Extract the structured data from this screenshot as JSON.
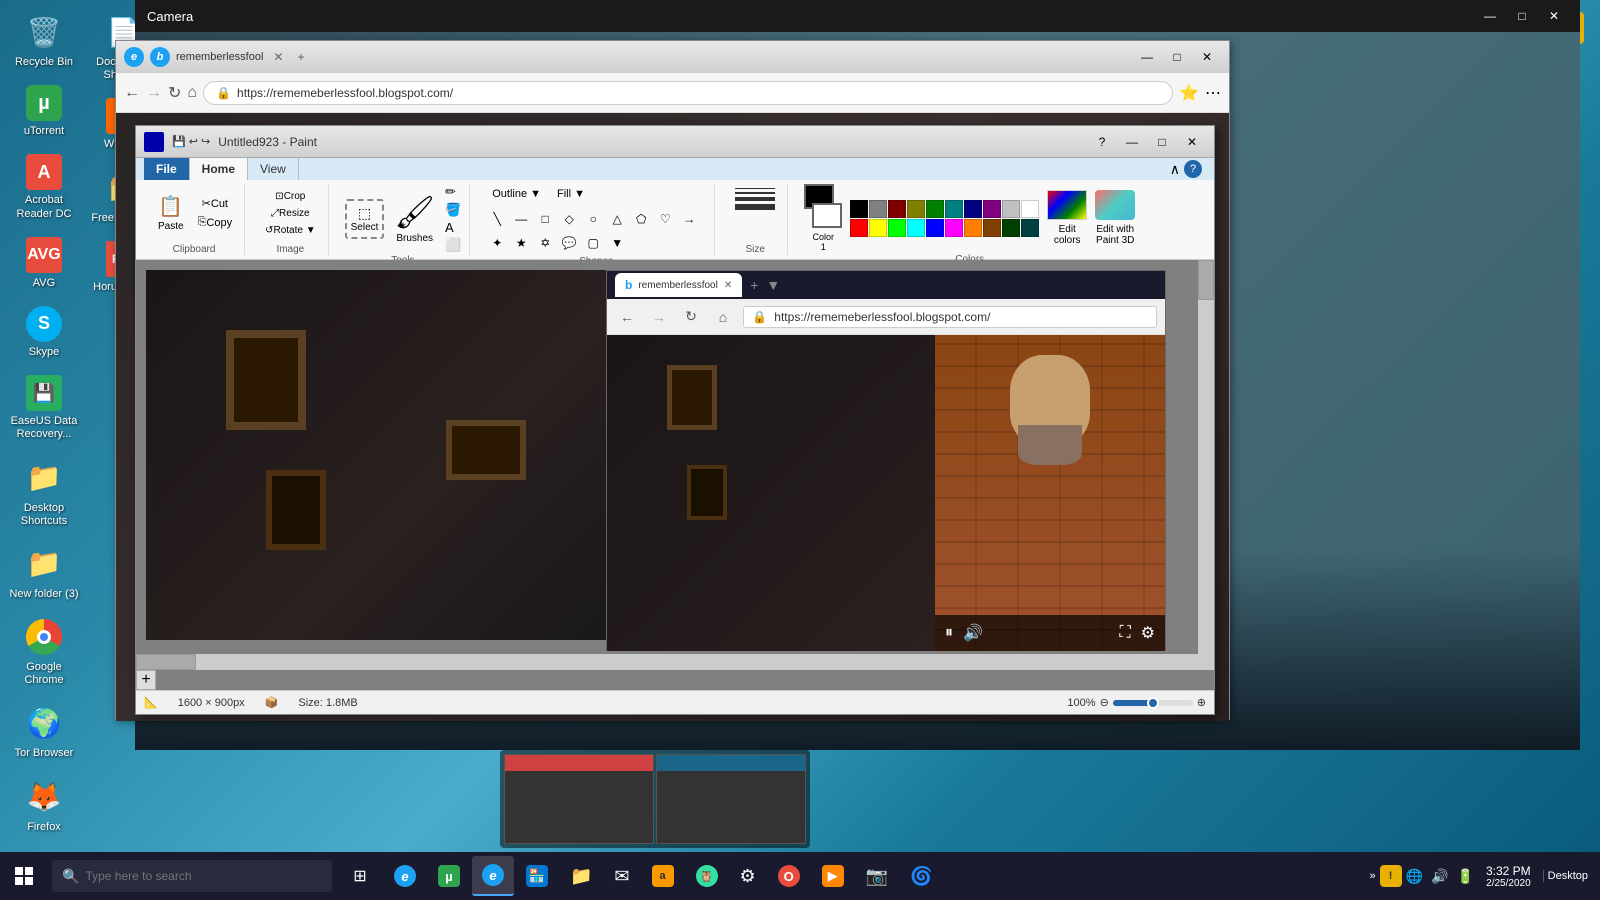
{
  "desktop": {
    "background": "teal"
  },
  "taskbar": {
    "search_placeholder": "Type here to search",
    "time": "3:32 PM",
    "date": "2/25/2020",
    "desktop_label": "Desktop",
    "apps": [
      {
        "label": "Edge",
        "active": false
      },
      {
        "label": "uTorrent",
        "active": false
      },
      {
        "label": "Camera",
        "active": true
      },
      {
        "label": "Paint",
        "active": true
      }
    ]
  },
  "desktop_icons_col1": [
    {
      "label": "Recycle Bin",
      "icon": "🗑️"
    },
    {
      "label": "uTorrent",
      "icon": "⬇"
    },
    {
      "label": "Acrobat Reader DC",
      "icon": "📄"
    },
    {
      "label": "AVG",
      "icon": "🛡"
    },
    {
      "label": "Skype",
      "icon": "💬"
    },
    {
      "label": "EaseUS Data Recovery...",
      "icon": "💾"
    },
    {
      "label": "Desktop Shortcuts",
      "icon": "📁"
    },
    {
      "label": "New folder (3)",
      "icon": "📁"
    },
    {
      "label": "Google Chrome",
      "icon": "🌐"
    },
    {
      "label": "Tor Browser",
      "icon": "🌍"
    },
    {
      "label": "Firefox",
      "icon": "🦊"
    }
  ],
  "desktop_icons_col2": [
    {
      "label": "Documents Shortcut",
      "icon": "📄"
    },
    {
      "label": "Winamp",
      "icon": "🎵"
    },
    {
      "label": "FreeFileVie...",
      "icon": "📁"
    },
    {
      "label": "Horus_Her...",
      "icon": "📄"
    }
  ],
  "desktop_icons_col3": [
    {
      "label": "Recycle Bin",
      "icon": "🗑️"
    },
    {
      "label": "µTorrent",
      "icon": "⬇"
    },
    {
      "label": "Acrobat Reader DC",
      "icon": "📄"
    },
    {
      "label": "AVG",
      "icon": "🛡"
    },
    {
      "label": "Documents Shortcut",
      "icon": "📄"
    },
    {
      "label": "Winamp",
      "icon": "🎵"
    },
    {
      "label": "Skype",
      "icon": "💬"
    },
    {
      "label": "EaseUS Data Recovery...",
      "icon": "💾"
    }
  ],
  "desktop_icons_right": [
    {
      "label": "⭐",
      "icon": "📁"
    }
  ],
  "camera_app": {
    "title": "Camera"
  },
  "paint_window": {
    "title": "Untitled923 - Paint",
    "tabs": [
      "File",
      "Home",
      "View"
    ],
    "active_tab": "Home",
    "ribbon": {
      "groups": [
        {
          "label": "Clipboard",
          "buttons": [
            "Paste",
            "Cut",
            "Copy"
          ]
        },
        {
          "label": "Image",
          "buttons": [
            "Crop",
            "Resize",
            "Rotate"
          ]
        },
        {
          "label": "Tools",
          "buttons": [
            "Select",
            "Brushes"
          ]
        },
        {
          "label": "Shapes",
          "shapes": [
            "\\",
            "—",
            "□",
            "◇",
            "○",
            "△",
            "⬠",
            "⭐",
            "→"
          ]
        },
        {
          "label": "Colors"
        }
      ]
    },
    "statusbar": {
      "dimensions": "1600 × 900px",
      "size": "Size: 1.8MB",
      "zoom": "100%"
    }
  },
  "browser": {
    "tab_title": "rememberlessfool",
    "url": "https://rememeberlessfool.blogspot.com/"
  },
  "inner_browser": {
    "tab_title": "rememberlessfool",
    "url": "https://rememeberlessfool.blogspot.com/"
  },
  "colors": [
    "#000000",
    "#808080",
    "#800000",
    "#808000",
    "#008000",
    "#008080",
    "#000080",
    "#800080",
    "#C0C0C0",
    "#ffffff",
    "#FF0000",
    "#FFFF00",
    "#00FF00",
    "#00FFFF",
    "#0000FF",
    "#FF00FF",
    "#FF8000",
    "#804000",
    "#004000",
    "#004040",
    "#000040",
    "#400040",
    "#FF8080",
    "#FFFF80",
    "#80FF80",
    "#80FFFF",
    "#8080FF",
    "#FF80FF",
    "#ffffff",
    "#ffffff",
    "#ffffff",
    "#ffffff",
    "#ffffff",
    "#D4A0A0",
    "#D4D4A0",
    "#A0D4A0",
    "#A0D4D4",
    "#A0A0D4",
    "#D4A0D4"
  ]
}
